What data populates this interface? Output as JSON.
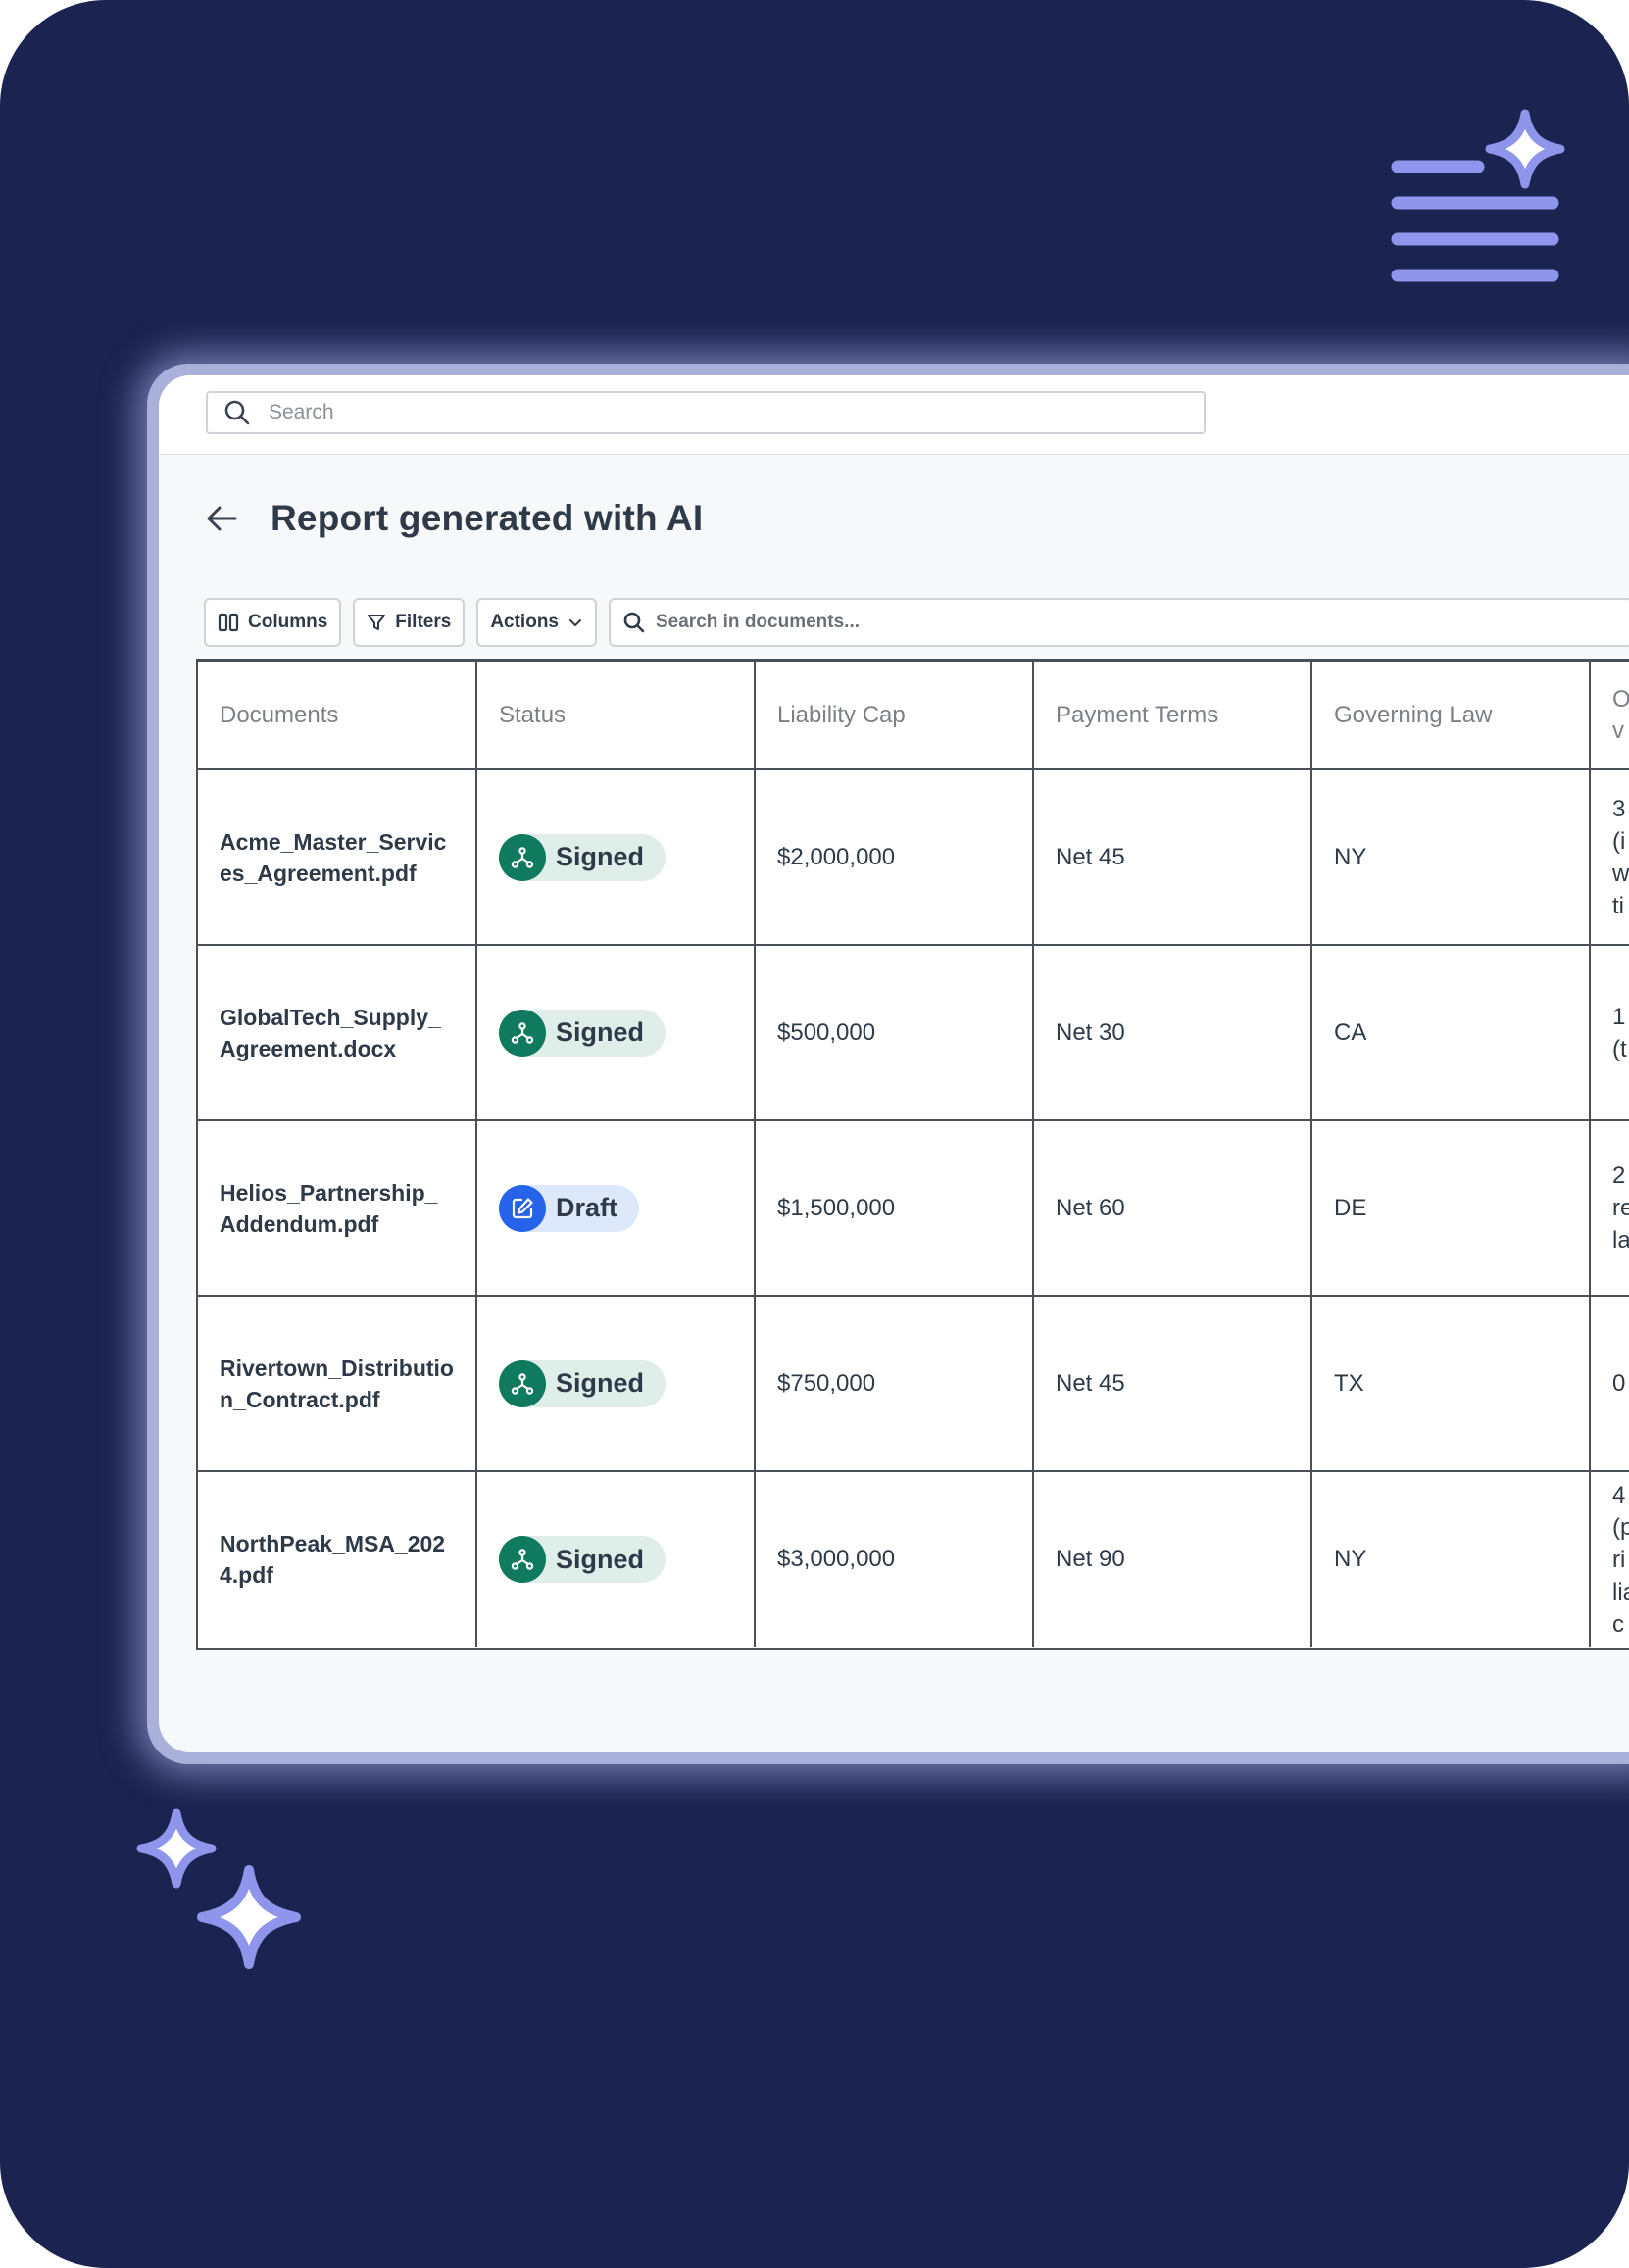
{
  "colors": {
    "background": "#1b2350",
    "accent": "#8f95ea",
    "signed_badge": "#0f7a5d",
    "draft_badge": "#2563eb"
  },
  "decorations": {
    "top_right": "ai-list-sparkle-icon",
    "bottom_left": "double-sparkle-icon"
  },
  "header": {
    "search_placeholder": "Search"
  },
  "page": {
    "title": "Report generated with AI",
    "back_icon": "arrow-left-icon"
  },
  "toolbar": {
    "columns_label": "Columns",
    "filters_label": "Filters",
    "actions_label": "Actions",
    "search_placeholder": "Search in documents..."
  },
  "table": {
    "columns": [
      "Documents",
      "Status",
      "Liability Cap",
      "Payment Terms",
      "Governing Law",
      "O\nv"
    ],
    "rows": [
      {
        "document": "Acme_Master_Services_Agreement.pdf",
        "status": "Signed",
        "liability_cap": "$2,000,000",
        "payment_terms": "Net 45",
        "governing_law": "NY",
        "next": "3\n(i\nw\nti"
      },
      {
        "document": "GlobalTech_Supply_Agreement.docx",
        "status": "Signed",
        "liability_cap": "$500,000",
        "payment_terms": "Net 30",
        "governing_law": "CA",
        "next": "1\n(t"
      },
      {
        "document": "Helios_Partnership_Addendum.pdf",
        "status": "Draft",
        "liability_cap": "$1,500,000",
        "payment_terms": "Net 60",
        "governing_law": "DE",
        "next": "2\nre\nla"
      },
      {
        "document": "Rivertown_Distribution_Contract.pdf",
        "status": "Signed",
        "liability_cap": "$750,000",
        "payment_terms": "Net 45",
        "governing_law": "TX",
        "next": "0"
      },
      {
        "document": "NorthPeak_MSA_2024.pdf",
        "status": "Signed",
        "liability_cap": "$3,000,000",
        "payment_terms": "Net 90",
        "governing_law": "NY",
        "next": "4\n(p\nri\nlia\nc"
      }
    ]
  }
}
